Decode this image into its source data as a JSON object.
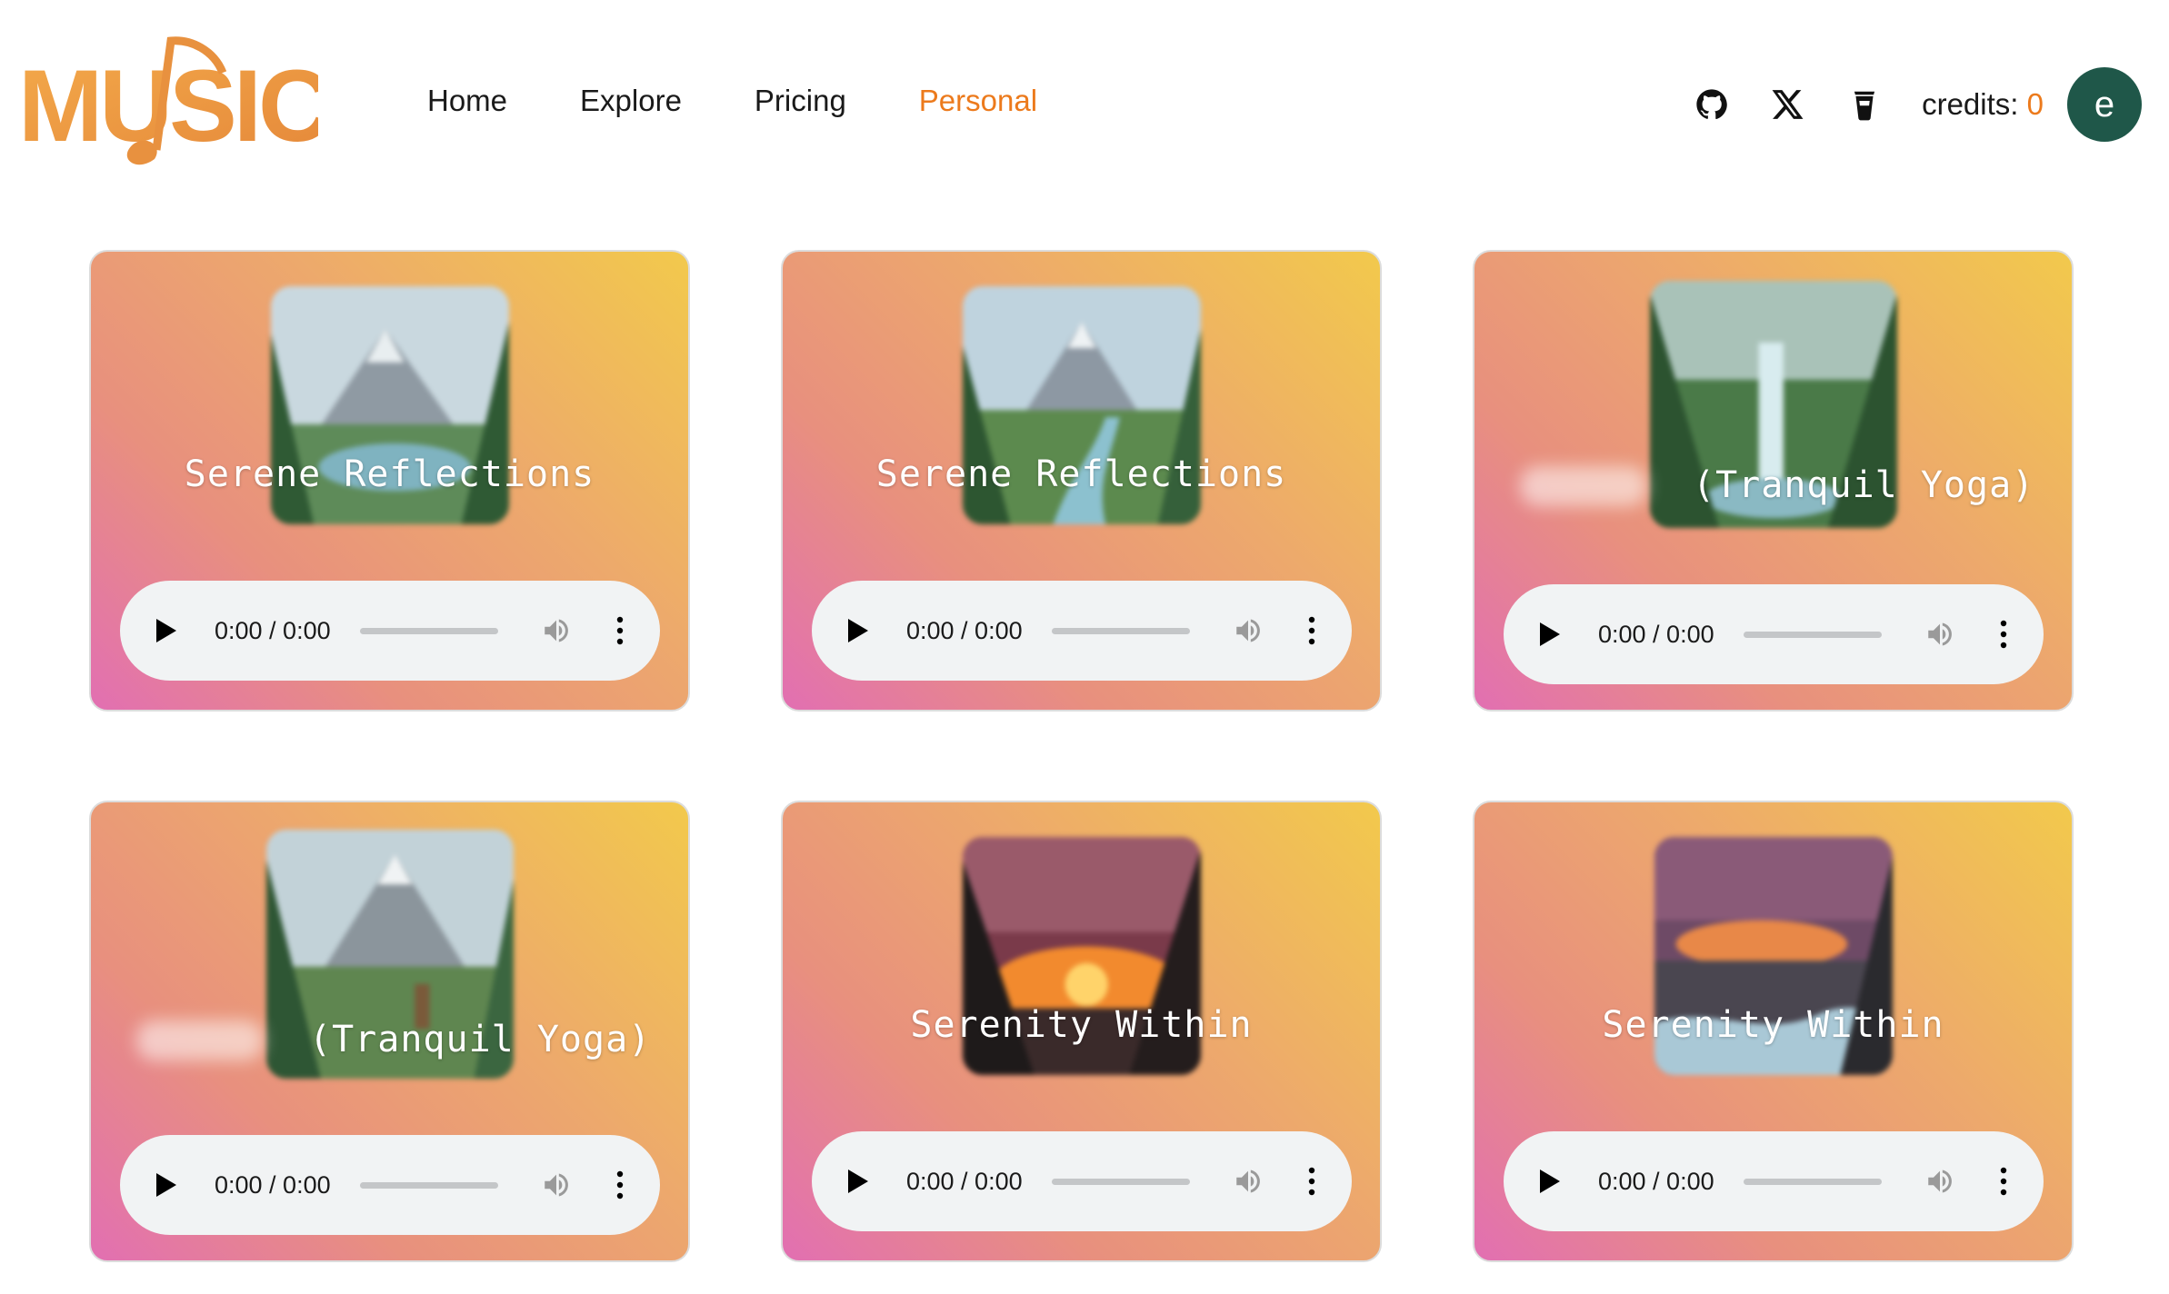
{
  "brand": {
    "logo_text": "MUSIC"
  },
  "nav": [
    {
      "label": "Home"
    },
    {
      "label": "Explore"
    },
    {
      "label": "Pricing"
    },
    {
      "label": "Personal"
    }
  ],
  "header": {
    "credits_label": "credits:",
    "credits_value": "0",
    "avatar_initial": "e",
    "icons": [
      "github-icon",
      "x-twitter-icon",
      "coffee-cup-icon"
    ]
  },
  "colors": {
    "accent": "#ec7a1c",
    "avatar_bg": "#1f5749",
    "player_bg": "#f1f3f4"
  },
  "cards": [
    {
      "title": "Serene Reflections",
      "time": "0:00 / 0:00",
      "scene": "mountain-lake"
    },
    {
      "title": "Serene Reflections",
      "time": "0:00 / 0:00",
      "scene": "mountain-river"
    },
    {
      "title": "(Tranquil Yoga)",
      "time": "0:00 / 0:00",
      "scene": "forest-waterfall"
    },
    {
      "title": "(Tranquil Yoga)",
      "time": "0:00 / 0:00",
      "scene": "mountain-forest"
    },
    {
      "title": "Serenity Within",
      "time": "0:00 / 0:00",
      "scene": "sunset-forest"
    },
    {
      "title": "Serenity Within",
      "time": "0:00 / 0:00",
      "scene": "sunset-river"
    }
  ]
}
